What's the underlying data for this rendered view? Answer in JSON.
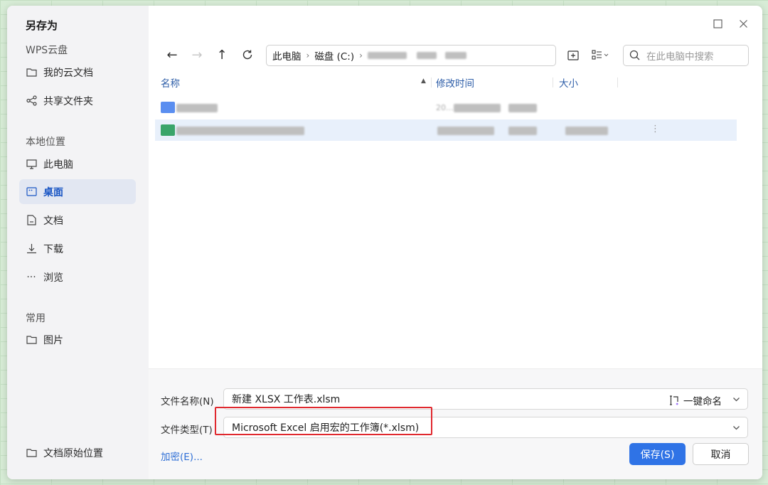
{
  "dialog": {
    "title": "另存为",
    "window_buttons": [
      "maximize-icon",
      "close-icon"
    ]
  },
  "sidebar": {
    "cloud_section": "WPS云盘",
    "cloud_items": [
      {
        "label": "我的云文档",
        "icon": "folder-icon"
      },
      {
        "label": "共享文件夹",
        "icon": "share-icon"
      }
    ],
    "local_section": "本地位置",
    "local_items": [
      {
        "label": "此电脑",
        "icon": "monitor-icon"
      },
      {
        "label": "桌面",
        "icon": "desktop-icon",
        "active": true
      },
      {
        "label": "文档",
        "icon": "document-icon"
      },
      {
        "label": "下载",
        "icon": "download-icon"
      },
      {
        "label": "浏览",
        "icon": "more-icon"
      }
    ],
    "common_section": "常用",
    "common_items": [
      {
        "label": "图片",
        "icon": "folder-icon"
      }
    ],
    "bottom_item": {
      "label": "文档原始位置",
      "icon": "folder-icon"
    }
  },
  "toolbar": {
    "address": [
      "此电脑",
      "磁盘 (C:)"
    ],
    "search_placeholder": "在此电脑中搜索"
  },
  "file_list": {
    "columns": [
      "名称",
      "修改时间",
      "大小"
    ],
    "partial_date_text": "20..."
  },
  "footer": {
    "filename_label": "文件名称(N)",
    "filename_value": "新建 XLSX 工作表.xlsm",
    "auto_name_label": "一键命名",
    "filetype_label": "文件类型(T)",
    "filetype_value": "Microsoft Excel 启用宏的工作簿(*.xlsm)",
    "encrypt_link": "加密(E)...",
    "save_button": "保存(S)",
    "cancel_button": "取消"
  },
  "colors": {
    "accent": "#2f73e6",
    "highlight_border": "#e0282e",
    "active_nav": "#1a56c4"
  }
}
